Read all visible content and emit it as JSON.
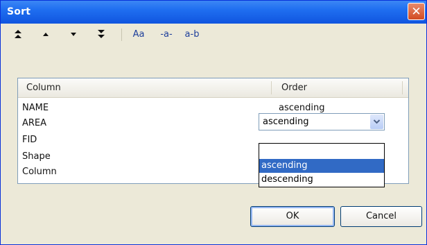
{
  "window": {
    "title": "Sort",
    "close_glyph": "✕"
  },
  "toolbar": {
    "move_top_icon": "move-to-top-icon",
    "move_up_icon": "move-up-icon",
    "move_down_icon": "move-down-icon",
    "move_bottom_icon": "move-to-bottom-icon",
    "case_label": "Aa",
    "a_label": "-a-",
    "ab_label": "a-b"
  },
  "grid": {
    "columns": [
      "Column",
      "Order"
    ],
    "rows": [
      {
        "column": "NAME",
        "order": "ascending"
      },
      {
        "column": "AREA",
        "order": ""
      },
      {
        "column": "FID",
        "order": ""
      },
      {
        "column": "Shape",
        "order": ""
      },
      {
        "column": "Column",
        "order": ""
      }
    ]
  },
  "combo": {
    "value": "ascending",
    "options": [
      "",
      "ascending",
      "descending"
    ],
    "selected_index": 1
  },
  "buttons": {
    "ok": "OK",
    "cancel": "Cancel"
  },
  "colors": {
    "titlebar": "#1f6ef0",
    "selection": "#316ac5",
    "close": "#d24b22"
  }
}
